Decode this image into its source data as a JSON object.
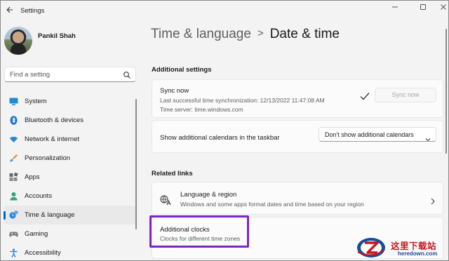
{
  "window": {
    "title": "Settings",
    "controls": [
      "minimize-icon",
      "maximize-icon",
      "close-icon"
    ]
  },
  "user": {
    "name": "Pankil Shah"
  },
  "search": {
    "placeholder": "Find a setting"
  },
  "sidebar": {
    "items": [
      {
        "label": "System",
        "icon": "system-icon",
        "active": false
      },
      {
        "label": "Bluetooth & devices",
        "icon": "bluetooth-icon",
        "active": false
      },
      {
        "label": "Network & internet",
        "icon": "wifi-icon",
        "active": false
      },
      {
        "label": "Personalization",
        "icon": "brush-icon",
        "active": false
      },
      {
        "label": "Apps",
        "icon": "apps-icon",
        "active": false
      },
      {
        "label": "Accounts",
        "icon": "person-icon",
        "active": false
      },
      {
        "label": "Time & language",
        "icon": "time-language-icon",
        "active": true
      },
      {
        "label": "Gaming",
        "icon": "controller-icon",
        "active": false
      },
      {
        "label": "Accessibility",
        "icon": "accessibility-icon",
        "active": false
      }
    ]
  },
  "breadcrumb": {
    "parent": "Time & language",
    "separator": ">",
    "current": "Date & time"
  },
  "additional_settings": {
    "heading": "Additional settings",
    "sync": {
      "title": "Sync now",
      "last_sync": "Last successful time synchronization: 12/13/2022 11:47:08 AM",
      "time_server": "Time server: time.windows.com",
      "button_label": "Sync now"
    },
    "calendars": {
      "label": "Show additional calendars in the taskbar",
      "selected": "Don't show additional calendars"
    }
  },
  "related_links": {
    "heading": "Related links",
    "language_region": {
      "title": "Language & region",
      "subtitle": "Windows and some apps format dates and time based on your region"
    },
    "additional_clocks": {
      "title": "Additional clocks",
      "subtitle": "Clocks for different time zones"
    }
  },
  "watermark": {
    "chinese": "这里下载站",
    "url": "heredown.com"
  },
  "colors": {
    "accent": "#0067c0",
    "highlight_box": "#7c26c4",
    "watermark_red": "#c8171f",
    "watermark_blue": "#1a4b9c"
  }
}
